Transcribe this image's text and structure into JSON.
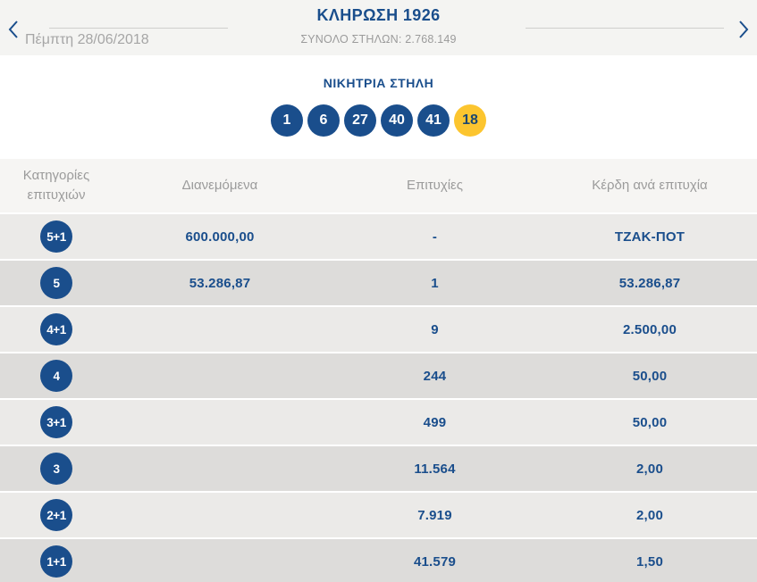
{
  "header": {
    "title": "ΚΛΗΡΩΣΗ 1926",
    "total_columns_label": "ΣΥΝΟΛΟ ΣΤΗΛΩΝ: 2.768.149",
    "date": "Πέμπτη 28/06/2018"
  },
  "winning_column": {
    "label": "ΝΙΚΗΤΡΙΑ ΣΤΗΛΗ",
    "numbers": [
      "1",
      "6",
      "27",
      "40",
      "41"
    ],
    "joker_number": "18"
  },
  "results_table": {
    "headers": [
      "Κατηγορίες επιτυχιών",
      "Διανεμόμενα",
      "Επιτυχίες",
      "Κέρδη ανά επιτυχία"
    ],
    "rows": [
      {
        "category": "5+1",
        "distributed": "600.000,00",
        "hits": "-",
        "winnings_per_hit": "ΤΖΑΚ-ΠΟΤ"
      },
      {
        "category": "5",
        "distributed": "53.286,87",
        "hits": "1",
        "winnings_per_hit": "53.286,87"
      },
      {
        "category": "4+1",
        "distributed": "",
        "hits": "9",
        "winnings_per_hit": "2.500,00"
      },
      {
        "category": "4",
        "distributed": "",
        "hits": "244",
        "winnings_per_hit": "50,00"
      },
      {
        "category": "3+1",
        "distributed": "",
        "hits": "499",
        "winnings_per_hit": "50,00"
      },
      {
        "category": "3",
        "distributed": "",
        "hits": "11.564",
        "winnings_per_hit": "2,00"
      },
      {
        "category": "2+1",
        "distributed": "",
        "hits": "7.919",
        "winnings_per_hit": "2,00"
      },
      {
        "category": "1+1",
        "distributed": "",
        "hits": "41.579",
        "winnings_per_hit": "1,50"
      }
    ]
  },
  "colors": {
    "accent_blue": "#1a4e8c",
    "joker_yellow": "#fcc52f",
    "topbar_background": "#f4f4f2",
    "table_header_background": "#f6f5f3",
    "row_light": "#ebeae8",
    "row_dark": "#dddcda",
    "muted_text": "#9b9b9b"
  }
}
